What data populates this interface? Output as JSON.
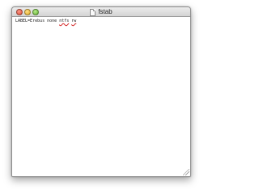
{
  "window": {
    "title": "fstab",
    "title_icon": "document-icon"
  },
  "editor": {
    "line_1": {
      "prefix": "LABEL=Erebus none ",
      "token_1": "ntfs",
      "space": " ",
      "token_2": "rw"
    }
  },
  "colors": {
    "close": "#d9452f",
    "minimize": "#e0a81f",
    "zoom": "#5fae2d",
    "spellcheck_underline": "#d21f1f"
  }
}
